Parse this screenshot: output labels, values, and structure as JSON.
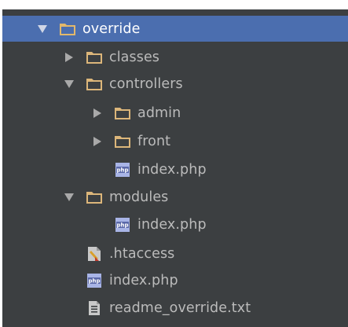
{
  "tree": {
    "root": {
      "label": "override",
      "expanded": true,
      "icon": "folder-icon"
    },
    "items": [
      {
        "label": "classes",
        "expanded": false,
        "icon": "folder-icon"
      },
      {
        "label": "controllers",
        "expanded": true,
        "icon": "folder-icon"
      },
      {
        "label": "admin",
        "expanded": false,
        "icon": "folder-icon"
      },
      {
        "label": "front",
        "expanded": false,
        "icon": "folder-icon"
      },
      {
        "label": "index.php",
        "icon": "php-file-icon"
      },
      {
        "label": "modules",
        "expanded": true,
        "icon": "folder-icon"
      },
      {
        "label": "index.php",
        "icon": "php-file-icon"
      },
      {
        "label": ".htaccess",
        "icon": "htaccess-file-icon"
      },
      {
        "label": "index.php",
        "icon": "php-file-icon"
      },
      {
        "label": "readme_override.txt",
        "icon": "text-file-icon"
      }
    ]
  },
  "colors": {
    "background": "#3c3f41",
    "selection": "#4b6eaf",
    "text": "#bbbbbb",
    "folder": "#dcb67a",
    "arrow": "#a9a9a9"
  }
}
